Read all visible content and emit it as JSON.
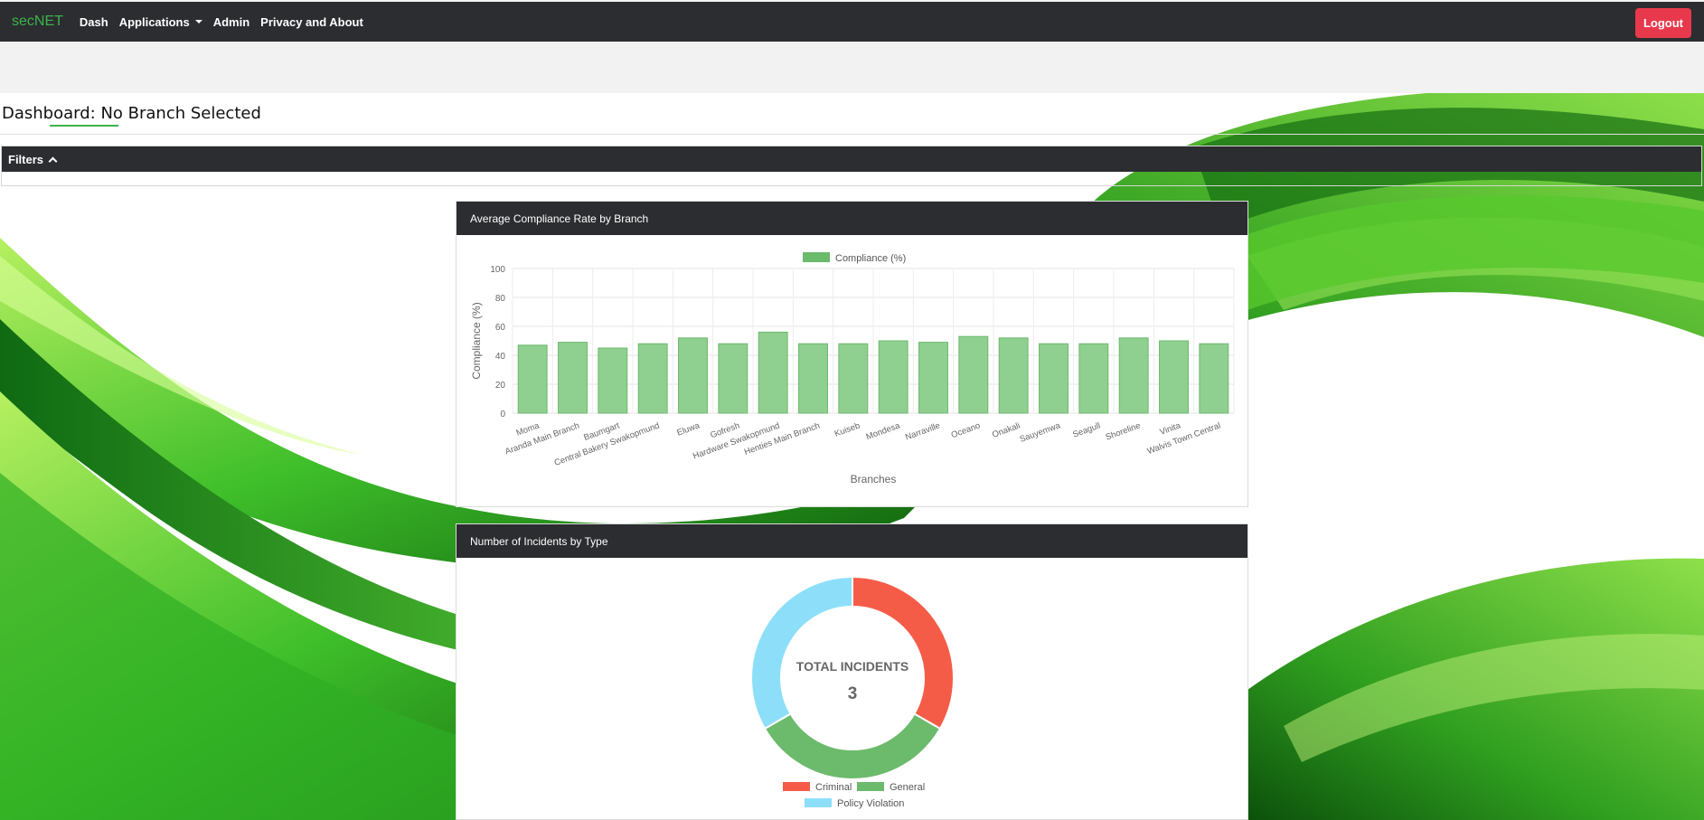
{
  "navbar": {
    "brand": "secNET",
    "items": [
      "Dash",
      "Applications",
      "Admin",
      "Privacy and About"
    ],
    "logout_label": "Logout"
  },
  "page": {
    "title": "Dashboard: No Branch Selected",
    "filters_label": "Filters"
  },
  "colors": {
    "navbar_bg": "#2b2d30",
    "brand": "#3cb44b",
    "logout": "#e8394c",
    "criminal": "#f45c47",
    "general": "#6cba6c",
    "policy_violation": "#8ddff9"
  },
  "charts": {
    "compliance": {
      "header": "Average Compliance Rate by Branch"
    },
    "incidents": {
      "header": "Number of Incidents by Type",
      "center_label": "TOTAL INCIDENTS",
      "center_value": "3"
    }
  },
  "chart_data": [
    {
      "type": "bar",
      "legend": [
        "Compliance (%)"
      ],
      "ylabel": "Compliance (%)",
      "xlabel": "Branches",
      "ylim": [
        0,
        100
      ],
      "yticks": [
        0,
        20,
        40,
        60,
        80,
        100
      ],
      "grid": true,
      "legend_position": "top",
      "categories": [
        "Moma",
        "Aranda Main Branch",
        "Baumgart",
        "Central Bakery Swakopmund",
        "Eluwa",
        "Gofresh",
        "Hardware Swakopmund",
        "Henties Main Branch",
        "Kuiseb",
        "Mondesa",
        "Narraville",
        "Oceano",
        "Onakali",
        "Sauyemwa",
        "Seagull",
        "Shoreline",
        "Vinita",
        "Walvis Town Central"
      ],
      "series": [
        {
          "name": "Compliance (%)",
          "values": [
            47,
            49,
            45,
            48,
            52,
            48,
            56,
            48,
            48,
            50,
            49,
            53,
            52,
            48,
            48,
            52,
            50,
            48
          ]
        }
      ]
    },
    {
      "type": "pie",
      "legend": [
        "Criminal",
        "General",
        "Policy Violation"
      ],
      "legend_position": "bottom",
      "categories": [
        "Criminal",
        "General",
        "Policy Violation"
      ],
      "values": [
        1,
        1,
        1
      ]
    }
  ]
}
